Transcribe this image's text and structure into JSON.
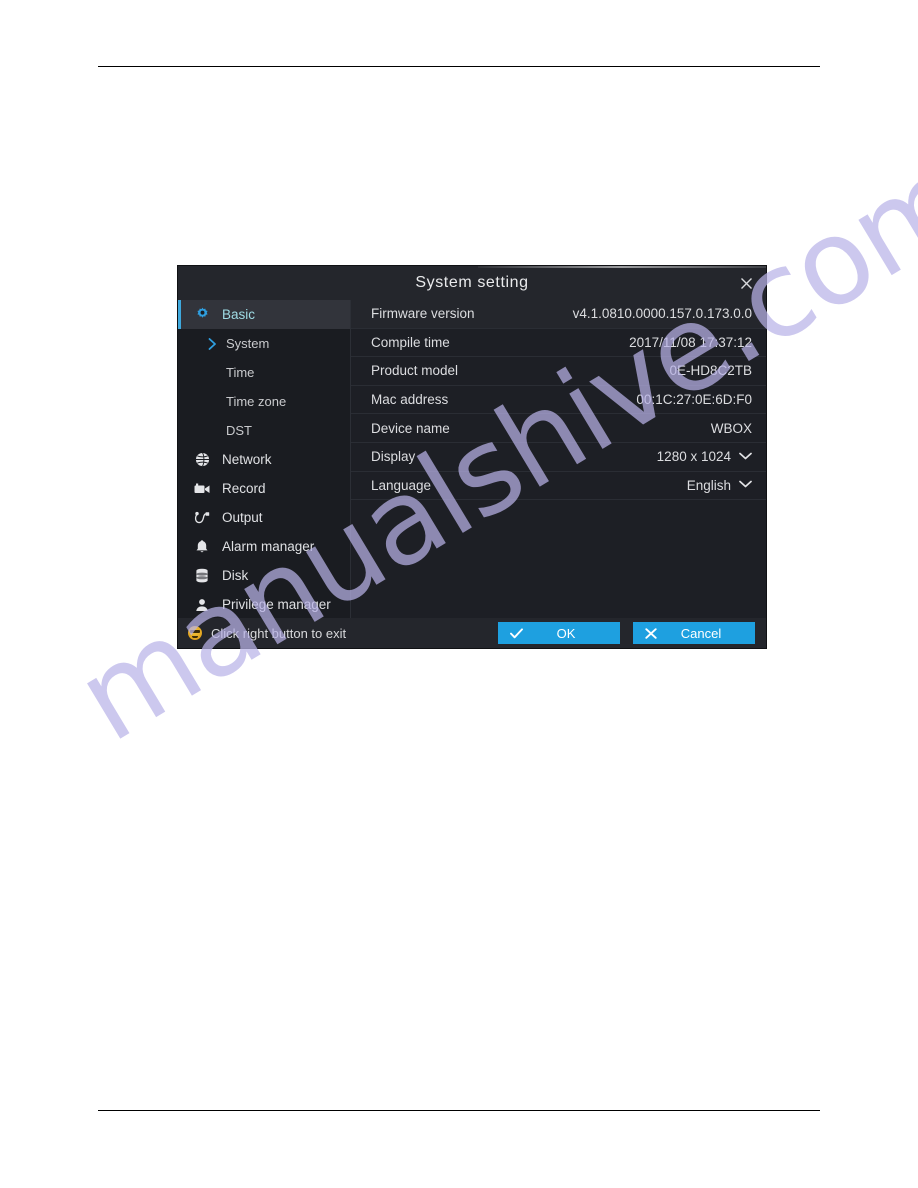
{
  "dialog": {
    "title": "System setting",
    "close_icon": "close-icon",
    "sidebar": {
      "items": [
        {
          "label": "Basic",
          "icon": "gear-icon",
          "level": "top",
          "selected": true
        },
        {
          "label": "System",
          "icon": "chevron-right-icon",
          "level": "sub",
          "selected": false
        },
        {
          "label": "Time",
          "icon": "",
          "level": "sub",
          "selected": false
        },
        {
          "label": "Time zone",
          "icon": "",
          "level": "sub",
          "selected": false
        },
        {
          "label": "DST",
          "icon": "",
          "level": "sub",
          "selected": false
        },
        {
          "label": "Network",
          "icon": "globe-icon",
          "level": "top",
          "selected": false
        },
        {
          "label": "Record",
          "icon": "video-camera-icon",
          "level": "top",
          "selected": false
        },
        {
          "label": "Output",
          "icon": "connector-icon",
          "level": "top",
          "selected": false
        },
        {
          "label": "Alarm manager",
          "icon": "bell-icon",
          "level": "top",
          "selected": false
        },
        {
          "label": "Disk",
          "icon": "disk-stack-icon",
          "level": "top",
          "selected": false
        },
        {
          "label": "Privilege manager",
          "icon": "user-icon",
          "level": "top",
          "selected": false
        }
      ]
    },
    "rows": [
      {
        "label": "Firmware version",
        "value": "v4.1.0810.0000.157.0.173.0.0",
        "dropdown": false
      },
      {
        "label": "Compile time",
        "value": "2017/11/08 17:37:12",
        "dropdown": false
      },
      {
        "label": "Product model",
        "value": "0E-HD8C2TB",
        "dropdown": false
      },
      {
        "label": "Mac address",
        "value": "00:1C:27:0E:6D:F0",
        "dropdown": false
      },
      {
        "label": "Device name",
        "value": "WBOX",
        "dropdown": false
      },
      {
        "label": "Display",
        "value": "1280 x 1024",
        "dropdown": true
      },
      {
        "label": "Language",
        "value": "English",
        "dropdown": true
      }
    ],
    "footer": {
      "smiley_icon": "smiley-icon",
      "hint": "Click right button to exit",
      "ok_label": "OK",
      "ok_icon": "check-icon",
      "cancel_label": "Cancel",
      "cancel_icon": "cross-icon"
    }
  },
  "watermark": {
    "text": "manualshive.com"
  },
  "colors": {
    "accent": "#1ea0e0",
    "selected_text": "#9fdbe4",
    "dialog_bg": "#1b1d22",
    "titlebar_bg": "#24262c",
    "watermark": "#b9b3e8"
  }
}
